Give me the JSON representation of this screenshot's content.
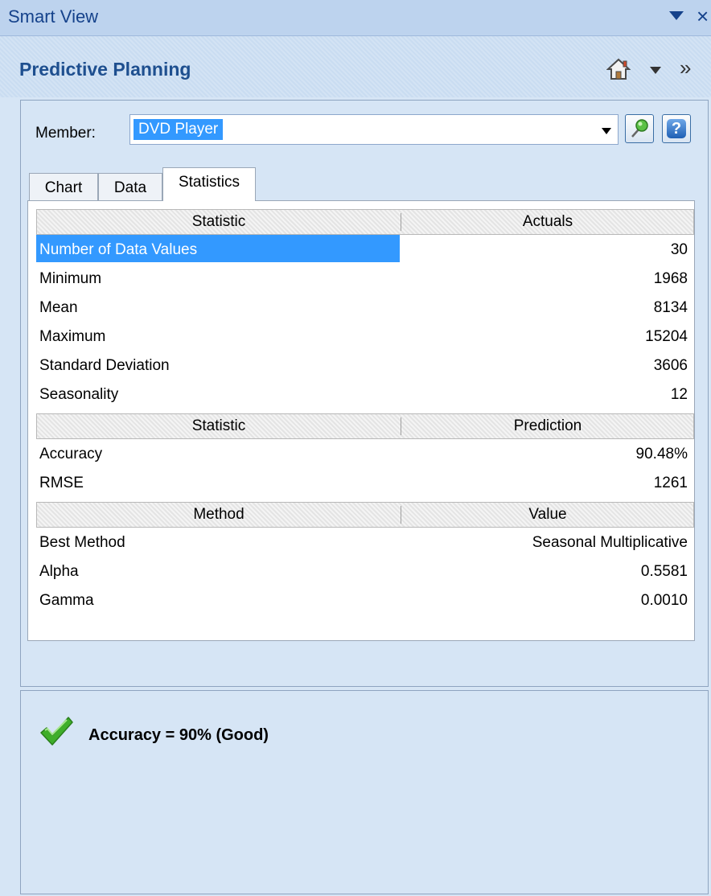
{
  "window": {
    "title": "Smart View"
  },
  "header": {
    "title": "Predictive Planning"
  },
  "member": {
    "label": "Member:",
    "value": "DVD Player"
  },
  "tabs": [
    {
      "label": "Chart"
    },
    {
      "label": "Data"
    },
    {
      "label": "Statistics"
    }
  ],
  "sections": [
    {
      "columns": [
        "Statistic",
        "Actuals"
      ],
      "rows": [
        {
          "name": "Number of Data Values",
          "value": "30"
        },
        {
          "name": "Minimum",
          "value": "1968"
        },
        {
          "name": "Mean",
          "value": "8134"
        },
        {
          "name": "Maximum",
          "value": "15204"
        },
        {
          "name": "Standard Deviation",
          "value": "3606"
        },
        {
          "name": "Seasonality",
          "value": "12"
        }
      ]
    },
    {
      "columns": [
        "Statistic",
        "Prediction"
      ],
      "rows": [
        {
          "name": "Accuracy",
          "value": "90.48%"
        },
        {
          "name": "RMSE",
          "value": "1261"
        }
      ]
    },
    {
      "columns": [
        "Method",
        "Value"
      ],
      "rows": [
        {
          "name": "Best Method",
          "value": "Seasonal Multiplicative"
        },
        {
          "name": "Alpha",
          "value": "0.5581"
        },
        {
          "name": "Gamma",
          "value": "0.0010"
        }
      ]
    }
  ],
  "status": {
    "text": "Accuracy = 90% (Good)"
  },
  "icons": {
    "home": "home-icon",
    "pin": "pin-icon",
    "help": "help-icon",
    "check": "check-icon"
  },
  "colors": {
    "selection": "#3399ff",
    "accent": "#1e4f8f",
    "check": "#3fae2a"
  }
}
